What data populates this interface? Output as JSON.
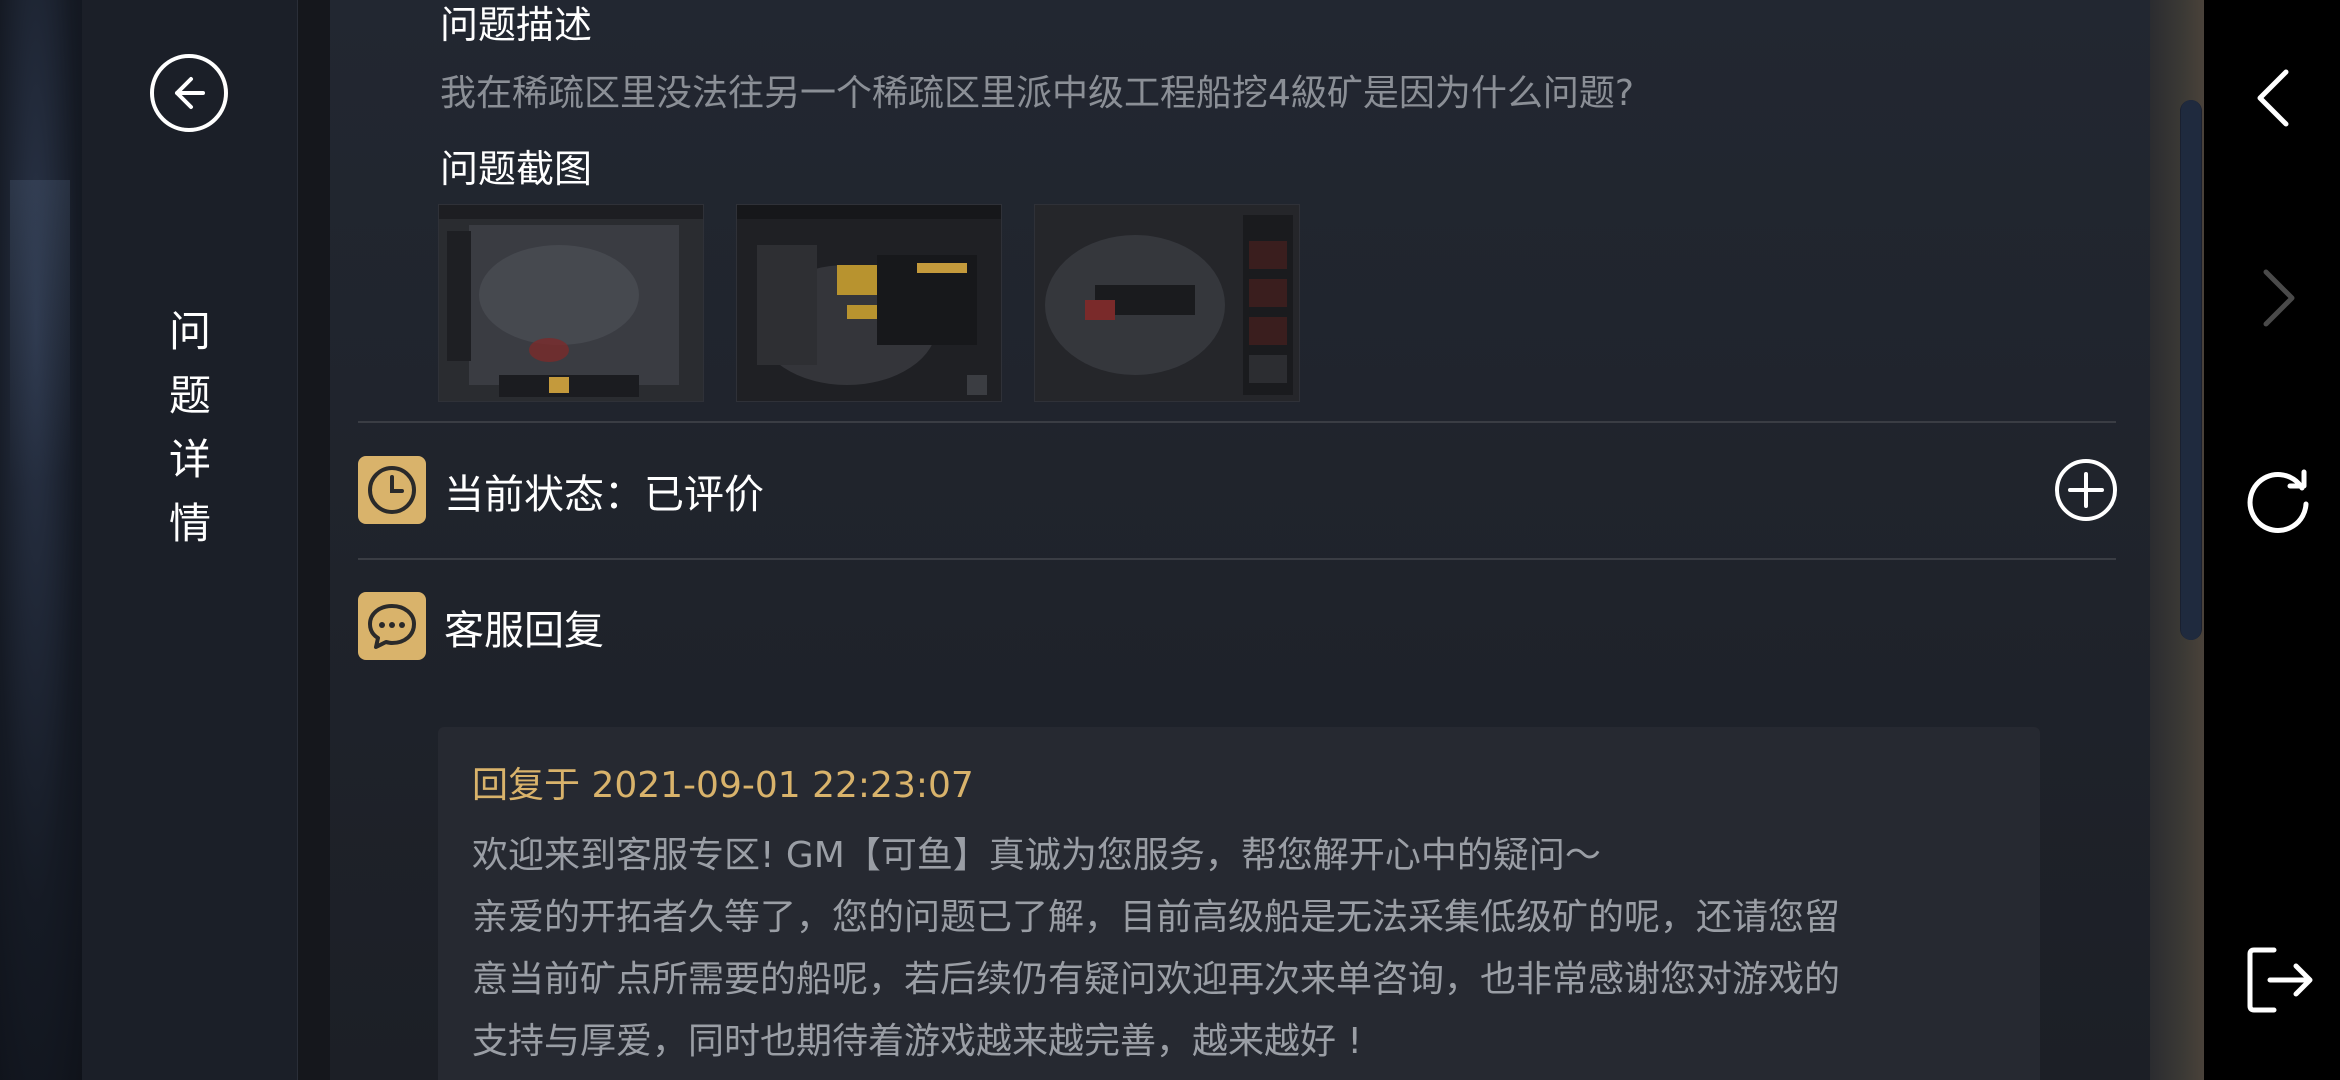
{
  "sidebar": {
    "title_chars": [
      "问",
      "题",
      "详",
      "情"
    ]
  },
  "question": {
    "desc_label": "问题描述",
    "desc_text": "我在稀疏区里没法往另一个稀疏区里派中级工程船挖4級矿是因为什么问题?",
    "screenshot_label": "问题截图",
    "screenshots": [
      "screenshot-1",
      "screenshot-2",
      "screenshot-3"
    ]
  },
  "status": {
    "label": "当前状态：已评价"
  },
  "reply": {
    "section_label": "客服回复",
    "time": "回复于 2021-09-01 22:23:07",
    "lines": [
      "欢迎来到客服专区! GM【可鱼】真诚为您服务，帮您解开心中的疑问～",
      "亲爱的开拓者久等了，您的问题已了解，目前高级船是无法采集低级矿的呢，还请您留",
      "意当前矿点所需要的船呢，若后续仍有疑问欢迎再次来单咨询，也非常感谢您对游戏的",
      "支持与厚爱，同时也期待着游戏越来越完善，越来越好 !"
    ]
  },
  "icons": {
    "back": "arrow-left-circle-icon",
    "status": "clock-icon",
    "expand": "plus-circle-icon",
    "reply": "chat-bubble-icon",
    "nav_back": "chevron-left-icon",
    "nav_forward": "chevron-right-icon",
    "refresh": "refresh-icon",
    "exit": "exit-icon"
  },
  "colors": {
    "accent": "#d9b36b",
    "text_primary": "#ffffff",
    "text_secondary": "#8b8f96"
  }
}
